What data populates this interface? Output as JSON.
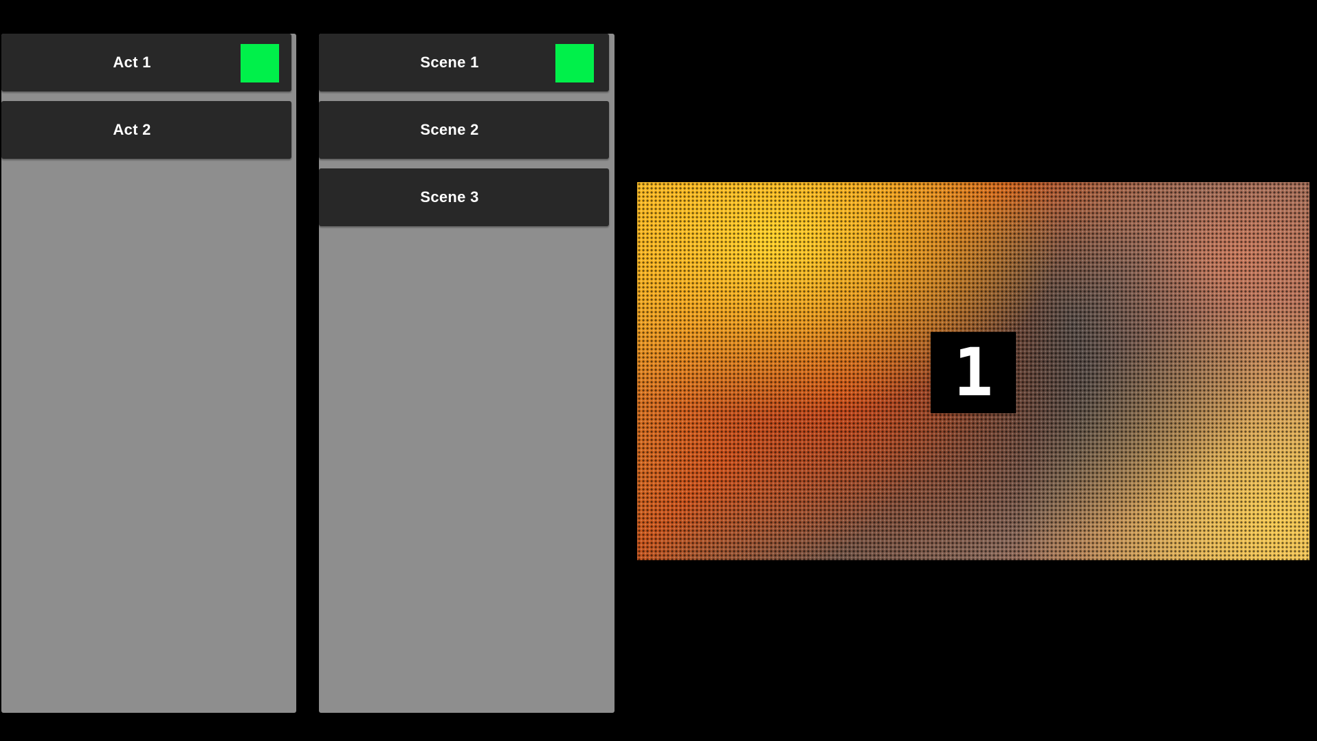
{
  "acts": {
    "items": [
      {
        "label": "Act 1",
        "active": true
      },
      {
        "label": "Act 2",
        "active": false
      }
    ]
  },
  "scenes": {
    "items": [
      {
        "label": "Scene 1",
        "active": true
      },
      {
        "label": "Scene 2",
        "active": false
      },
      {
        "label": "Scene 3",
        "active": false
      }
    ]
  },
  "preview": {
    "number": "1"
  },
  "colors": {
    "background": "#000000",
    "panel": "#8e8e8e",
    "item": "#282828",
    "active_indicator": "#00f04a",
    "text": "#ffffff"
  }
}
